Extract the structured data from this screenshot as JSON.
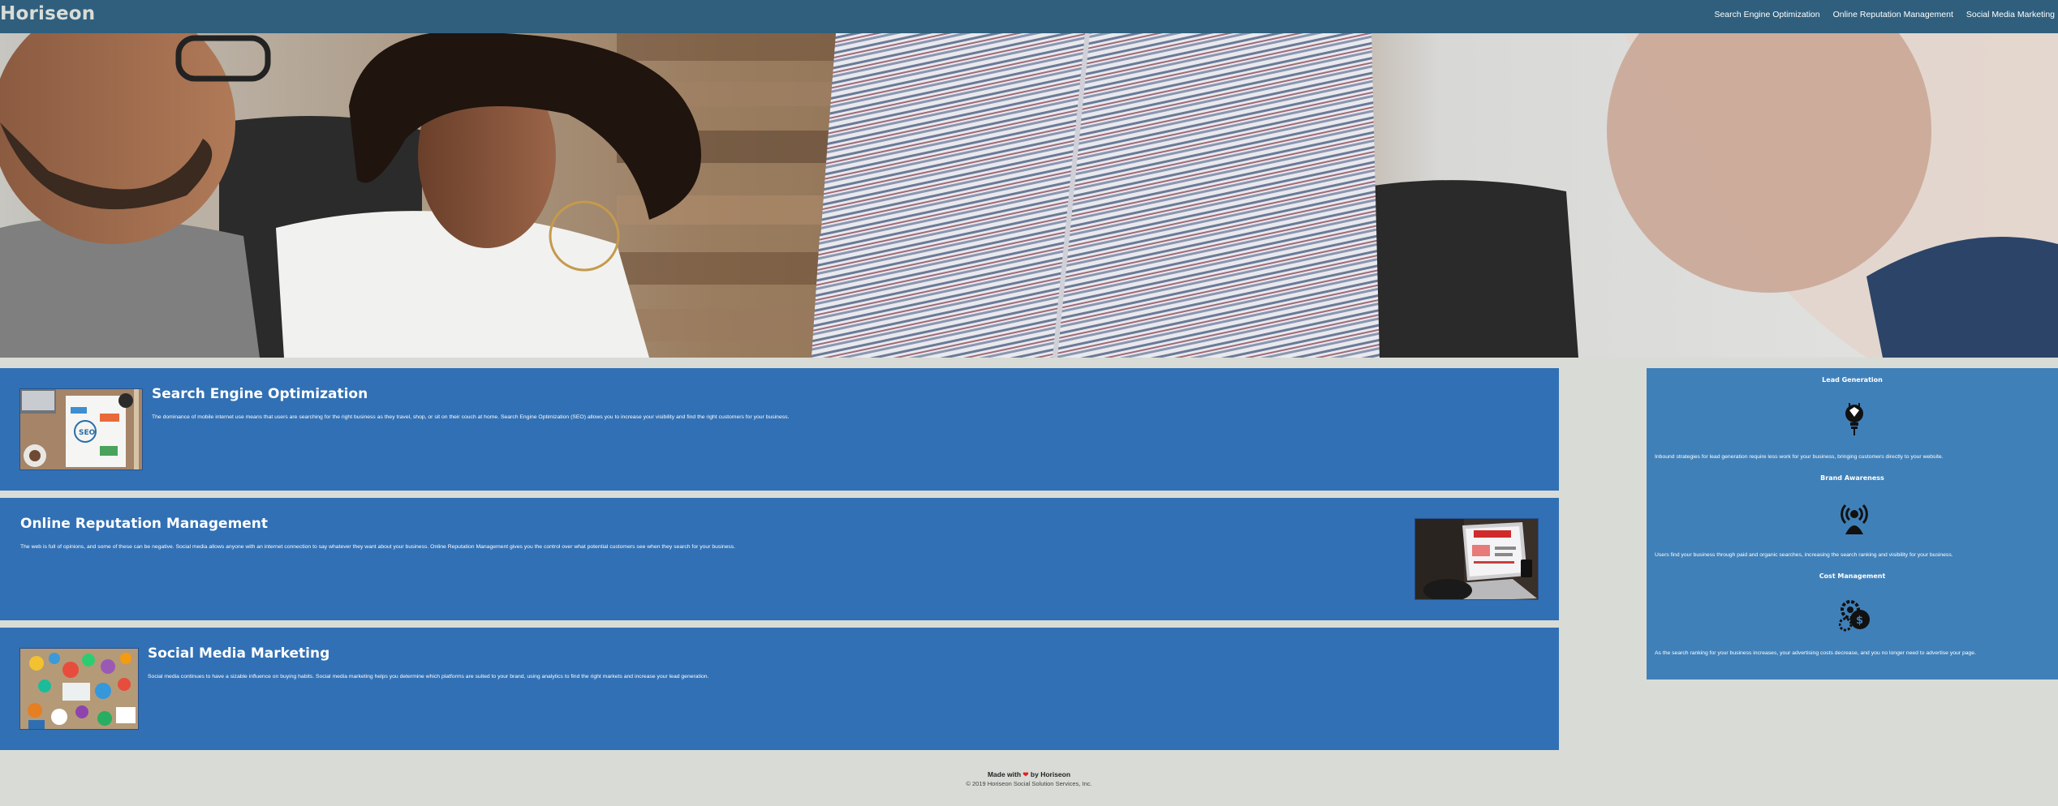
{
  "header": {
    "logo": "Horiseon",
    "nav": [
      {
        "label": "Search Engine Optimization"
      },
      {
        "label": "Online Reputation Management"
      },
      {
        "label": "Social Media Marketing"
      }
    ]
  },
  "services": [
    {
      "title": "Search Engine Optimization",
      "text": "The dominance of mobile internet use means that users are searching for the right business as they travel, shop, or sit on their couch at home. Search Engine Optimization (SEO) allows you to increase your visibility and find the right customers for your business."
    },
    {
      "title": "Online Reputation Management",
      "text": "The web is full of opinions, and some of these can be negative. Social media allows anyone with an internet connection to say whatever they want about your business. Online Reputation Management gives you the control over what potential customers see when they search for your business."
    },
    {
      "title": "Social Media Marketing",
      "text": "Social media continues to have a sizable influence on buying habits. Social media marketing helps you determine which platforms are suited to your brand, using analytics to find the right markets and increase your lead generation."
    }
  ],
  "benefits": [
    {
      "title": "Lead Generation",
      "icon": "lightbulb-lead-icon",
      "text": "Inbound strategies for lead generation require less work for your business, bringing customers directly to your website."
    },
    {
      "title": "Brand Awareness",
      "icon": "broadcast-person-icon",
      "text": "Users find your business through paid and organic searches, increasing the search ranking and visibility for your business."
    },
    {
      "title": "Cost Management",
      "icon": "gears-dollar-icon",
      "text": "As the search ranking for your business increases, your advertising costs decrease, and you no longer need to advertise your page."
    }
  ],
  "footer": {
    "made_with": "Made with",
    "heart": "❤",
    "by": "by Horiseon",
    "copyright": "© 2019 Horiseon Social Solution Services, Inc."
  },
  "colors": {
    "header": "#2f5f7d",
    "background": "#d9dcd6",
    "card": "#3170b4",
    "sidebar": "#4080b8"
  }
}
